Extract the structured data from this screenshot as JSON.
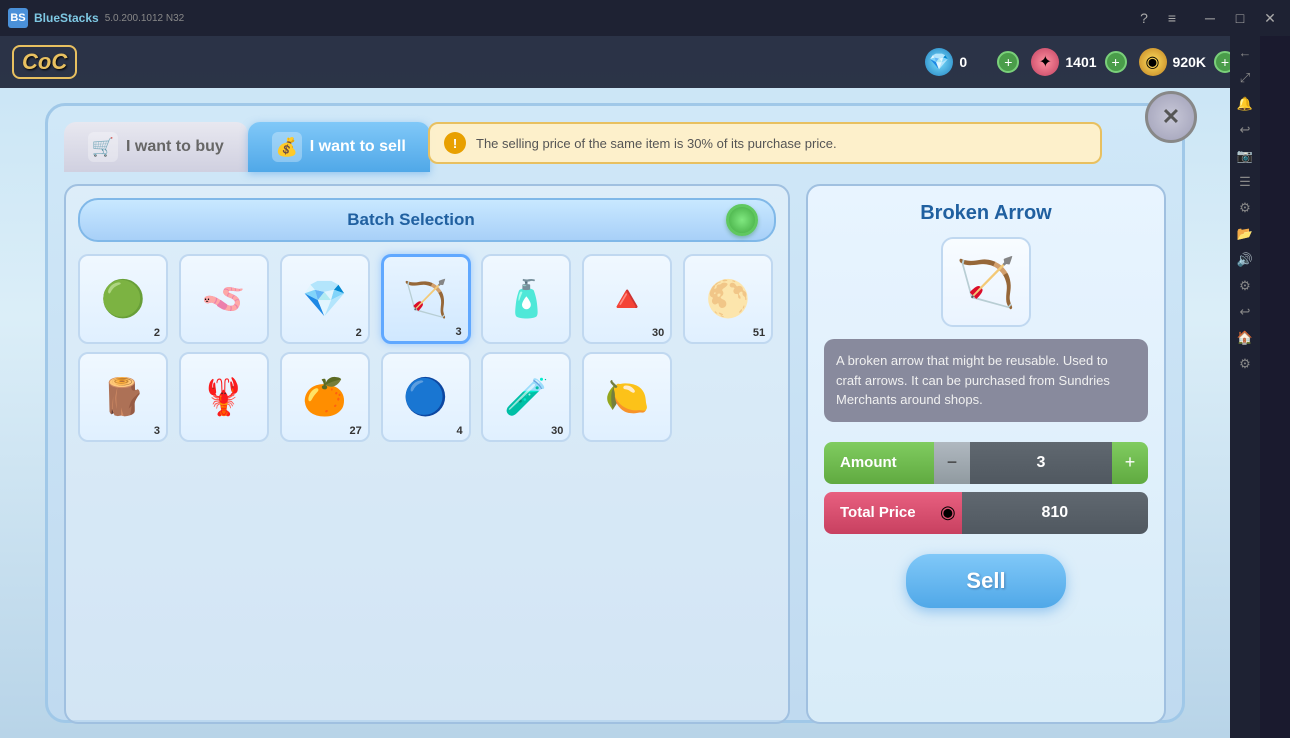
{
  "titlebar": {
    "brand": "BlueStacks",
    "version": "5.0.200.1012 N32",
    "help_icon": "?",
    "menu_icon": "≡",
    "minimize_icon": "─",
    "restore_icon": "□",
    "close_icon": "✕"
  },
  "hud": {
    "logo": "CoC",
    "gem_count": "0",
    "crystal_count": "1401",
    "coin_count": "920K"
  },
  "modal": {
    "close_icon": "✕",
    "tabs": [
      {
        "id": "buy",
        "label": "I want to buy",
        "active": false
      },
      {
        "id": "sell",
        "label": "I want to sell",
        "active": true
      }
    ],
    "info_text": "The selling price of the same item is 30% of its purchase price.",
    "batch_label": "Batch Selection",
    "item_name": "Broken Arrow",
    "item_description": "A broken arrow that might be reusable. Used to craft arrows. It can be purchased from Sundries Merchants around shops.",
    "amount_label": "Amount",
    "amount_value": "3",
    "total_price_label": "Total Price",
    "total_price_value": "810",
    "sell_button_label": "Sell",
    "items": [
      {
        "id": 1,
        "emoji": "🟢",
        "count": "2",
        "selected": false
      },
      {
        "id": 2,
        "emoji": "🪱",
        "count": "",
        "selected": false
      },
      {
        "id": 3,
        "emoji": "💎",
        "count": "2",
        "selected": false
      },
      {
        "id": 4,
        "emoji": "🏹",
        "count": "3",
        "selected": true
      },
      {
        "id": 5,
        "emoji": "🧴",
        "count": "",
        "selected": false
      },
      {
        "id": 6,
        "emoji": "🔺",
        "count": "30",
        "selected": false
      },
      {
        "id": 7,
        "emoji": "🟡",
        "count": "51",
        "selected": false
      },
      {
        "id": 8,
        "emoji": "🪵",
        "count": "3",
        "selected": false
      },
      {
        "id": 9,
        "emoji": "🦞",
        "count": "",
        "selected": false
      },
      {
        "id": 10,
        "emoji": "🍊",
        "count": "27",
        "selected": false
      },
      {
        "id": 11,
        "emoji": "🔵",
        "count": "4",
        "selected": false
      },
      {
        "id": 12,
        "emoji": "🧪",
        "count": "30",
        "selected": false
      },
      {
        "id": 13,
        "emoji": "🍋",
        "count": "",
        "selected": false
      }
    ]
  },
  "sidebar_icons": [
    "←",
    "↑",
    "↓",
    "⚙",
    "⚙",
    "⚙",
    "☰",
    "⚙",
    "⚙",
    "↩",
    "🏠",
    "⚙"
  ]
}
